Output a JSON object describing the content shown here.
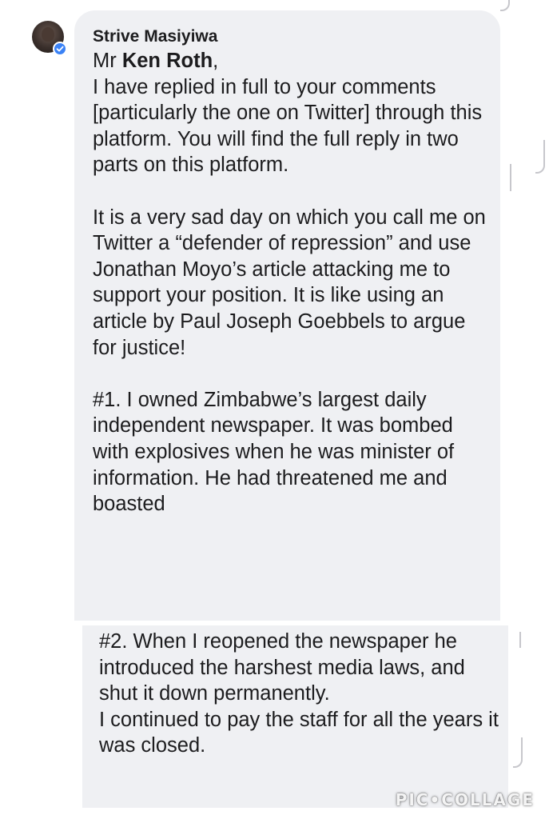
{
  "post": {
    "author": "Strive Masiyiwa",
    "salutation_prefix": "Mr ",
    "mention": "Ken Roth",
    "salutation_suffix": ",",
    "paragraph1": "I have replied in full to your comments [particularly the one on Twitter] through this platform. You will find the full reply in two parts on this platform.",
    "paragraph2": "It is a very sad day on which you call me on Twitter a “defender of repression” and use Jonathan Moyo’s article attacking me to support your position. It is like using an article by Paul Joseph Goebbels to argue for justice!",
    "paragraph3": "#1. I owned Zimbabwe’s largest daily independent newspaper. It was bombed with explosives when he was minister of information. He had threatened me and boasted"
  },
  "continuation": {
    "paragraph1": "#2. When I reopened the newspaper he introduced the harshest media laws, and shut it down permanently.",
    "paragraph2": "I continued to pay the staff for all the years it was closed."
  },
  "watermark": "PIC•COLLAGE",
  "icons": {
    "avatar": "profile-photo",
    "verified": "verified-badge-icon"
  },
  "colors": {
    "bubble": "#eff0f3",
    "text": "#1c1c1e",
    "verified": "#3b82f6"
  }
}
